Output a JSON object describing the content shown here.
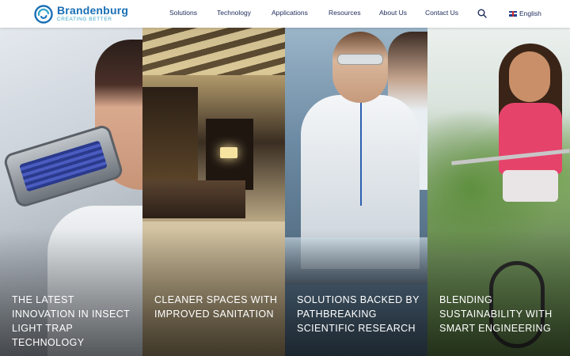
{
  "brand": {
    "name": "Brandenburg",
    "tagline": "CREATING BETTER",
    "colors": {
      "primary": "#1a6fb5",
      "accent": "#39a6c9",
      "nav_text": "#1c2a5a"
    }
  },
  "nav": {
    "items": [
      "Solutions",
      "Technology",
      "Applications",
      "Resources",
      "About Us",
      "Contact Us"
    ],
    "search_icon": "search-icon",
    "language": "English",
    "language_flag": "uk-flag-icon"
  },
  "panels": [
    {
      "title": "The latest innovation in insect light trap technology",
      "image": "woman-with-insect-light-trap"
    },
    {
      "title": "Cleaner spaces with improved sanitation",
      "image": "hotel-lobby-reception"
    },
    {
      "title": "Solutions backed by pathbreaking scientific research",
      "image": "scientists-in-lab"
    },
    {
      "title": "Blending sustainability with smart engineering",
      "image": "girl-riding-bicycle"
    }
  ]
}
